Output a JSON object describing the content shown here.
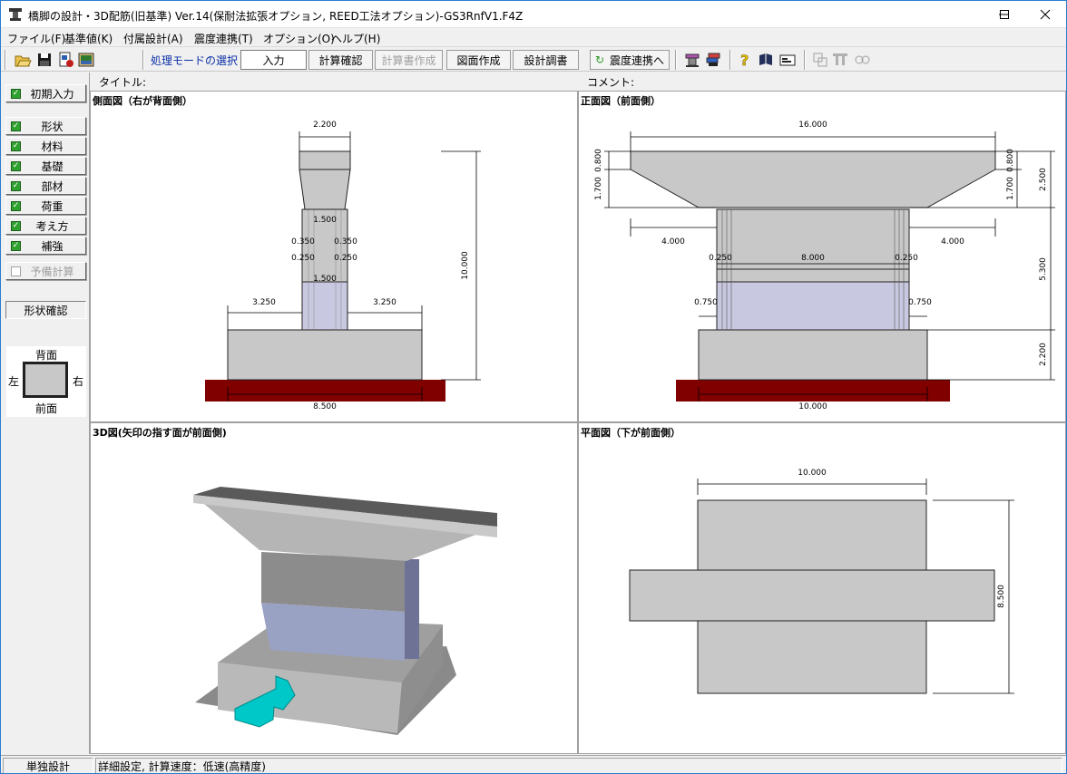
{
  "window": {
    "title": "橋脚の設計・3D配筋(旧基準) Ver.14(保耐法拡張オプション, REED工法オプション)-GS3RnfV1.F4Z",
    "minimize_glyph": "—",
    "maximize_glyph": "☐",
    "close_glyph": "✕"
  },
  "menu": [
    {
      "label": "ファイル(F)"
    },
    {
      "label": "基準値(K)"
    },
    {
      "label": "付属設計(A)"
    },
    {
      "label": "震度連携(T)"
    },
    {
      "label": "オプション(O)"
    },
    {
      "label": "ヘルプ(H)"
    }
  ],
  "toolbar": {
    "mode_label": "処理モードの選択",
    "input": "入力",
    "calc_check": "計算確認",
    "report": "計算書作成",
    "drawing": "図面作成",
    "design_doc": "設計調書",
    "seismic": "震度連携へ"
  },
  "sidebar": {
    "initial_input": "初期入力",
    "items": [
      {
        "label": "形状",
        "checked": true
      },
      {
        "label": "材料",
        "checked": true
      },
      {
        "label": "基礎",
        "checked": true
      },
      {
        "label": "部材",
        "checked": true
      },
      {
        "label": "荷重",
        "checked": true
      },
      {
        "label": "考え方",
        "checked": true
      },
      {
        "label": "補強",
        "checked": true
      }
    ],
    "preliminary": "予備計算",
    "shape_check": "形状確認",
    "orientation": {
      "back": "背面",
      "left": "左",
      "right": "右",
      "front": "前面"
    }
  },
  "header": {
    "title_label": "タイトル:",
    "comment_label": "コメント:"
  },
  "panels": {
    "side": {
      "title": "側面図（右が背面側）",
      "dims": {
        "top_width": "2.200",
        "col_width": "1.500",
        "left_edge": "0.350",
        "right_edge": "0.350",
        "left_cover": "0.250",
        "right_cover": "0.250",
        "col_width2": "1.500",
        "left_ext": "3.250",
        "right_ext": "3.250",
        "height": "10.000",
        "footing": "8.500"
      }
    },
    "front": {
      "title": "正面図（前面側）",
      "dims": {
        "top_width": "16.000",
        "left_h1": "0.800",
        "left_h2": "1.700",
        "right_h1": "0.800",
        "right_h2": "1.700",
        "right_total": "2.500",
        "left_overhang": "4.000",
        "right_overhang": "4.000",
        "left_cover": "0.250",
        "col_width": "8.000",
        "right_cover": "0.250",
        "col_height": "5.300",
        "left_ext": "0.750",
        "right_ext": "0.750",
        "footing_h": "2.200",
        "footing": "10.000"
      }
    },
    "iso": {
      "title": "3D図(矢印の指す面が前面側)"
    },
    "plan": {
      "title": "平面図（下が前面側）",
      "dims": {
        "width": "10.000",
        "depth": "8.500"
      }
    }
  },
  "status": {
    "mode": "単独設計",
    "detail": "詳細設定, 計算速度：低速(高精度)"
  },
  "colors": {
    "concrete": "#c8c8c8",
    "column_blue": "#c8c8e0",
    "ground": "#800000",
    "check_green": "#2fa12f",
    "arrow_cyan": "#00c8c8"
  }
}
